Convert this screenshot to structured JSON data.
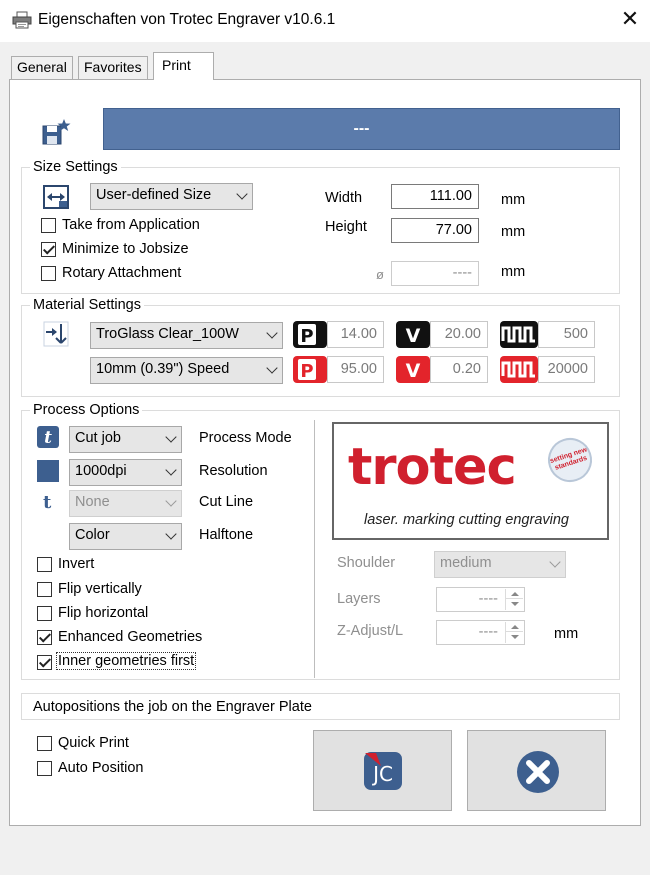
{
  "window": {
    "title": "Eigenschaften von Trotec Engraver v10.6.1",
    "close_glyph": "✕"
  },
  "tabs": [
    {
      "label": "General",
      "active": false
    },
    {
      "label": "Favorites",
      "active": false
    },
    {
      "label": "Print",
      "active": true
    }
  ],
  "job_name": {
    "value": "---",
    "color": "#5b7bab"
  },
  "size_settings": {
    "title": "Size Settings",
    "size_preset": "User-defined Size",
    "take_from_application": {
      "label": "Take from Application",
      "checked": false
    },
    "minimize_to_jobsize": {
      "label": "Minimize to Jobsize",
      "checked": true
    },
    "rotary_attachment": {
      "label": "Rotary Attachment",
      "checked": false
    },
    "width_label": "Width",
    "width_value": "111.00",
    "height_label": "Height",
    "height_value": "77.00",
    "diameter_symbol": "ø",
    "diameter_value": "----",
    "unit": "mm"
  },
  "material_settings": {
    "title": "Material Settings",
    "material": "TroGlass Clear_100W",
    "process_preset": "10mm (0.39\") Speed",
    "row1": {
      "power": "14.00",
      "velocity": "20.00",
      "frequency": "500"
    },
    "row2": {
      "power": "95.00",
      "velocity": "0.20",
      "frequency": "20000"
    },
    "icon_glyphs": {
      "power": "P",
      "velocity": "V"
    },
    "black": "#111111",
    "red": "#e3242b"
  },
  "process_options": {
    "title": "Process Options",
    "process_mode": {
      "value": "Cut job",
      "label": "Process Mode"
    },
    "resolution": {
      "value": "1000dpi",
      "label": "Resolution"
    },
    "cut_line": {
      "value": "None",
      "label": "Cut Line"
    },
    "halftone": {
      "value": "Color",
      "label": "Halftone"
    },
    "invert": {
      "label": "Invert",
      "checked": false
    },
    "flip_vertically": {
      "label": "Flip vertically",
      "checked": false
    },
    "flip_horizontal": {
      "label": "Flip horizontal",
      "checked": false
    },
    "enhanced_geometries": {
      "label": "Enhanced Geometries",
      "checked": true
    },
    "inner_geometries_first": {
      "label": "Inner geometries first",
      "checked": true
    },
    "cut_line_icon_glyph": "t",
    "shoulder": {
      "label": "Shoulder",
      "value": "medium"
    },
    "layers": {
      "label": "Layers",
      "value": "----"
    },
    "z_adjust": {
      "label": "Z-Adjust/L",
      "value": "----",
      "unit": "mm"
    }
  },
  "logo": {
    "brand": "trotec",
    "tagline": "laser. marking cutting engraving",
    "seal_text": "setting new standards",
    "brand_color": "#d0202e"
  },
  "status_text": "Autopositions the job on the Engraver Plate",
  "quick_print": {
    "label": "Quick Print",
    "checked": false
  },
  "auto_position": {
    "label": "Auto Position",
    "checked": false
  },
  "buttons": {
    "jc_glyph": "JC",
    "cancel_glyph": "✖"
  }
}
